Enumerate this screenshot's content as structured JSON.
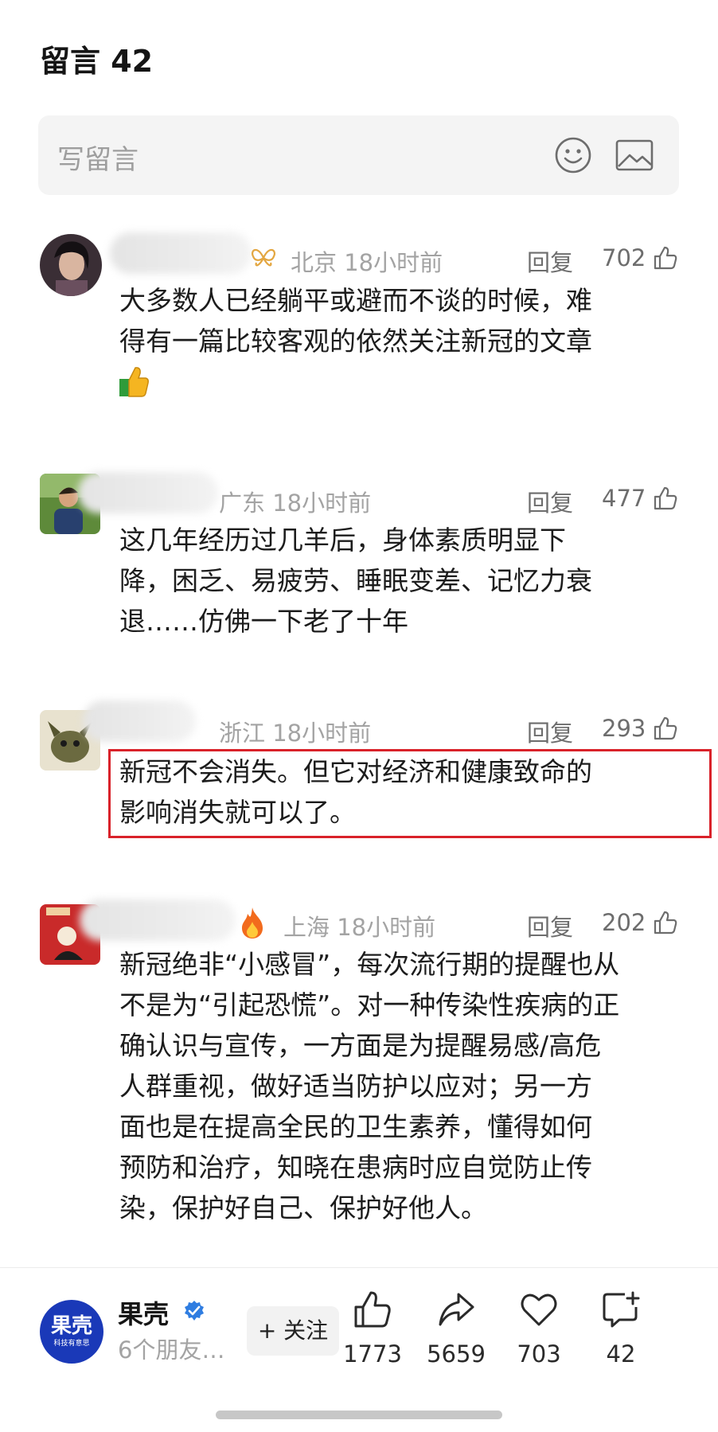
{
  "header": {
    "title": "留言 42"
  },
  "compose": {
    "placeholder": "写留言",
    "emoji_icon": "emoji-smile-icon",
    "image_icon": "image-icon"
  },
  "comments": [
    {
      "location_time": "北京 18小时前",
      "reply_label": "回复",
      "likes": "702",
      "lines": [
        "大多数人已经躺平或避而不谈的时候，难",
        "得有一篇比较客观的依然关注新冠的文章"
      ],
      "badge_icon": "butterfly-icon",
      "extra_icon": "thumbs-up-emoji-icon"
    },
    {
      "location_time": "广东 18小时前",
      "reply_label": "回复",
      "likes": "477",
      "lines": [
        "这几年经历过几羊后，身体素质明显下",
        "降，困乏、易疲劳、睡眠变差、记忆力衰",
        "退……仿佛一下老了十年"
      ]
    },
    {
      "location_time": "浙江 18小时前",
      "reply_label": "回复",
      "likes": "293",
      "lines": [
        "新冠不会消失。但它对经济和健康致命的",
        "影响消失就可以了。"
      ],
      "highlighted": true,
      "highlight_color": "#d9222a"
    },
    {
      "location_time": "上海 18小时前",
      "reply_label": "回复",
      "likes": "202",
      "badge_icon": "fire-icon",
      "lines": [
        "新冠绝非“小感冒”，每次流行期的提醒也从",
        "不是为“引起恐慌”。对一种传染性疾病的正",
        "确认识与宣传，一方面是为提醒易感/高危",
        "人群重视，做好适当防护以应对；另一方",
        "面也是在提高全民的卫生素养，懂得如何",
        "预防和治疗，知晓在患病时应自觉防止传",
        "染，保护好自己、保护好他人。"
      ]
    }
  ],
  "footer": {
    "account_name": "果壳",
    "avatar_text": "果壳",
    "avatar_subtext": "科技有意思",
    "account_sub": "6个朋友…",
    "follow_label": "+ 关注",
    "brand_color": "#1a39b8",
    "actions": [
      {
        "icon": "thumbs-up-icon",
        "count": "1773"
      },
      {
        "icon": "share-icon",
        "count": "5659"
      },
      {
        "icon": "heart-icon",
        "count": "703"
      },
      {
        "icon": "comment-add-icon",
        "count": "42"
      }
    ]
  }
}
